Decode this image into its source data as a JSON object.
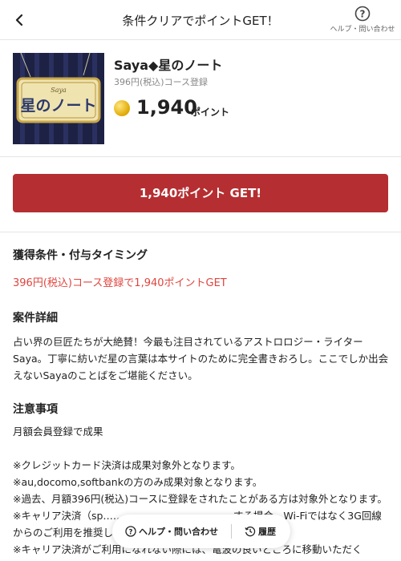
{
  "header": {
    "title": "条件クリアでポイントGET！",
    "help_label": "ヘルプ・問い合わせ"
  },
  "product": {
    "thumb_brand": "Saya",
    "thumb_title": "星のノート",
    "name": "Saya◆星のノート",
    "condition": "396円(税込)コース登録",
    "points": "1,940",
    "points_unit": "ポイント"
  },
  "cta": {
    "label": "1,940ポイント GET!"
  },
  "sections": {
    "acquisition": {
      "title": "獲得条件・付与タイミング",
      "text": "396円(税込)コース登録で1,940ポイントGET"
    },
    "details": {
      "title": "案件詳細",
      "text": "占い界の巨匠たちが大絶賛！今最も注目されているアストロロジー・ライターSaya。丁寧に紡いだ星の言葉は本サイトのために完全書きおろし。ここでしか出会えないSayaのことばをご堪能ください。"
    },
    "notes": {
      "title": "注意事項",
      "lines": [
        "月額会員登録で成果",
        "",
        "※クレジットカード決済は成果対象外となります。",
        "※au,docomo,softbankの方のみ成果対象となります。",
        "※過去、月額396円(税込)コースに登録をされたことがある方は対象外となります。",
        "※キャリア決済（sp…………………………………する場合、Wi-Fiではなく3G回線からのご利用を推奨します。",
        "※キャリア決済がご利用になれない際には、電波の良いところに移動いただく"
      ]
    }
  },
  "bottom_bar": {
    "help_label": "ヘルプ・問い合わせ",
    "history_label": "履歴"
  },
  "colors": {
    "accent": "#b52e31",
    "condition_text": "#e0453f",
    "thumb_bg": "#1d2244",
    "coin": "#e0a800"
  },
  "icons": {
    "back": "chevron-left-icon",
    "help": "question-circle-icon",
    "coin": "coin-icon",
    "history": "history-clock-icon"
  }
}
